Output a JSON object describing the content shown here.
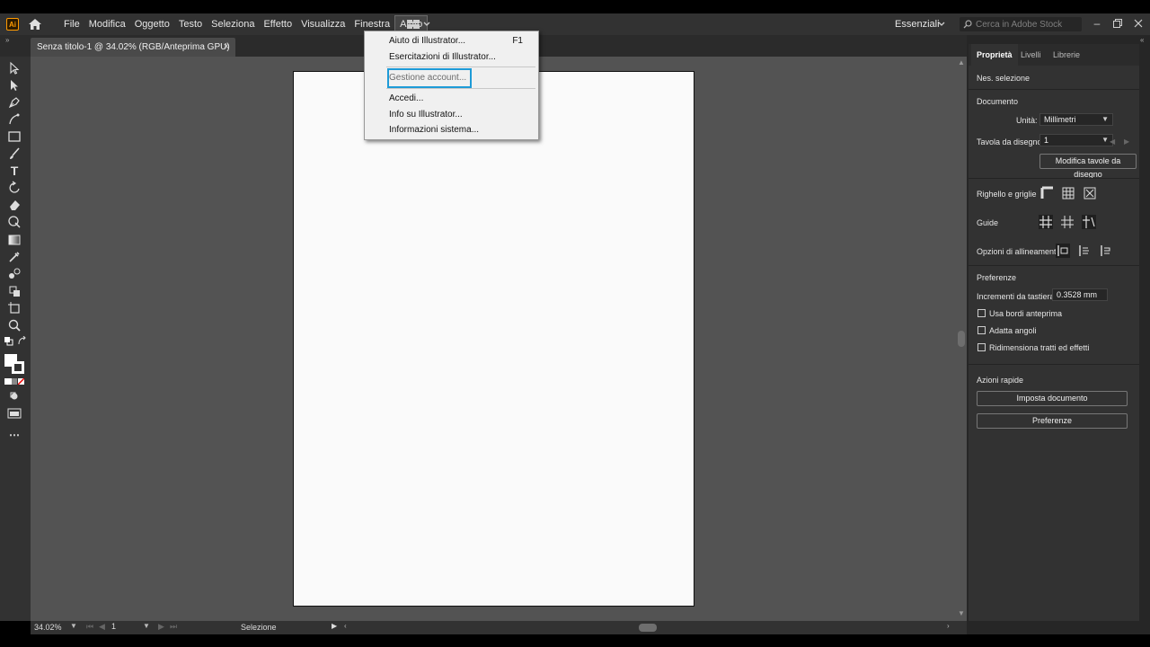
{
  "app": {
    "logo": "Ai",
    "menus": [
      "File",
      "Modifica",
      "Oggetto",
      "Testo",
      "Seleziona",
      "Effetto",
      "Visualizza",
      "Finestra",
      "Aiuto"
    ],
    "active_menu": "Aiuto",
    "workspace": "Essenziali",
    "search_placeholder": "Cerca in Adobe Stock"
  },
  "document": {
    "tab_title": "Senza titolo-1 @ 34.02% (RGB/Anteprima GPU)",
    "close_glyph": "×"
  },
  "help_menu": {
    "items": [
      {
        "label": "Aiuto di Illustrator...",
        "shortcut": "F1"
      },
      {
        "label": "Esercitazioni di Illustrator..."
      },
      {
        "label": "Gestione account...",
        "highlighted": true
      },
      {
        "label": "Accedi..."
      },
      {
        "label": "Info su Illustrator..."
      },
      {
        "label": "Informazioni sistema..."
      }
    ]
  },
  "status": {
    "zoom": "34.02%",
    "page": "1",
    "tool_label": "Selezione"
  },
  "properties_panel": {
    "tabs": [
      "Proprietà",
      "Livelli",
      "Librerie"
    ],
    "active_tab": "Proprietà",
    "no_selection": "Nes. selezione",
    "document_heading": "Documento",
    "units_label": "Unità:",
    "units_value": "Millimetri",
    "artboard_label": "Tavola da disegno:",
    "artboard_value": "1",
    "edit_artboards_button": "Modifica tavole da disegno",
    "rulers_grids_label": "Righello e griglie",
    "guides_label": "Guide",
    "align_options_label": "Opzioni di allineamento",
    "preferences_heading": "Preferenze",
    "keyboard_increment_label": "Incrementi da tastiera:",
    "keyboard_increment_value": "0.3528 mm",
    "checkboxes": [
      "Usa bordi anteprima",
      "Adatta angoli",
      "Ridimensiona tratti ed effetti"
    ],
    "quick_actions_heading": "Azioni rapide",
    "setup_document_button": "Imposta documento",
    "preferences_button": "Preferenze"
  },
  "colors": {
    "accent_highlight": "#1e9bd7",
    "logo_orange": "#ff9a00"
  }
}
